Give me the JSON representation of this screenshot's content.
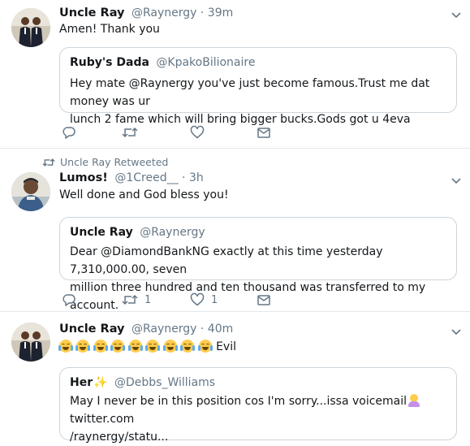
{
  "tweets": [
    {
      "name": "Uncle Ray",
      "handle": "@Raynergy",
      "separator": "·",
      "time": "39m",
      "text": "Amen!  Thank you",
      "quote": {
        "name": "Ruby's Dada",
        "handle": "@KpakoBilionaire",
        "lines": [
          "Hey mate @Raynergy you've just become famous.Trust me dat money was ur",
          "lunch 2 fame which will bring bigger bucks.Gods got u 4eva"
        ]
      },
      "actions": {
        "reply_count": "",
        "retweet_count": "",
        "like_count": ""
      }
    },
    {
      "retweet_banner": "Uncle Ray Retweeted",
      "name": "Lumos!",
      "handle": "@1Creed__",
      "separator": "·",
      "time": "3h",
      "text": "Well done and God bless you!",
      "quote": {
        "name": "Uncle Ray",
        "handle": "@Raynergy",
        "lines": [
          "Dear @DiamondBankNG exactly at this time yesterday 7,310,000.00, seven",
          "million three hundred and ten thousand was transferred to my account."
        ]
      },
      "actions": {
        "reply_count": "",
        "retweet_count": "1",
        "like_count": "1"
      }
    },
    {
      "name": "Uncle Ray",
      "handle": "@Raynergy",
      "separator": "·",
      "time": "40m",
      "text_suffix": "Evil",
      "quote": {
        "name": "Her",
        "handle": "@Debbs_Williams",
        "line1_prefix": "May I never be in this position cos I'm sorry...issa voicemail",
        "line1_suffix": "twitter.com",
        "line2": "/raynergy/statu..."
      }
    }
  ],
  "icons": {
    "reply": "reply-icon",
    "retweet": "retweet-icon",
    "like": "heart-icon",
    "dm": "envelope-icon",
    "caret": "chevron-down-icon"
  },
  "colors": {
    "muted": "#657786",
    "border": "#ccd6dd",
    "text": "#14171a"
  }
}
